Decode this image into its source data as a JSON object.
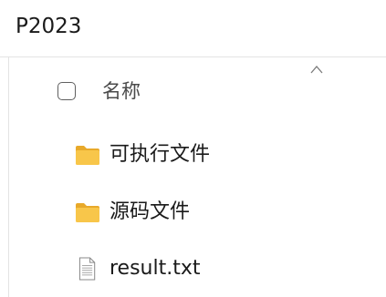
{
  "window": {
    "title": "P2023"
  },
  "list": {
    "header": {
      "name_label": "名称"
    },
    "items": [
      {
        "label": "可执行文件",
        "icon": "folder-icon"
      },
      {
        "label": "源码文件",
        "icon": "folder-icon"
      },
      {
        "label": "result.txt",
        "icon": "text-file-icon"
      }
    ]
  },
  "colors": {
    "folder": "#f8c64a",
    "folder_dark": "#e8a92a",
    "divider": "#e3e3e3"
  }
}
